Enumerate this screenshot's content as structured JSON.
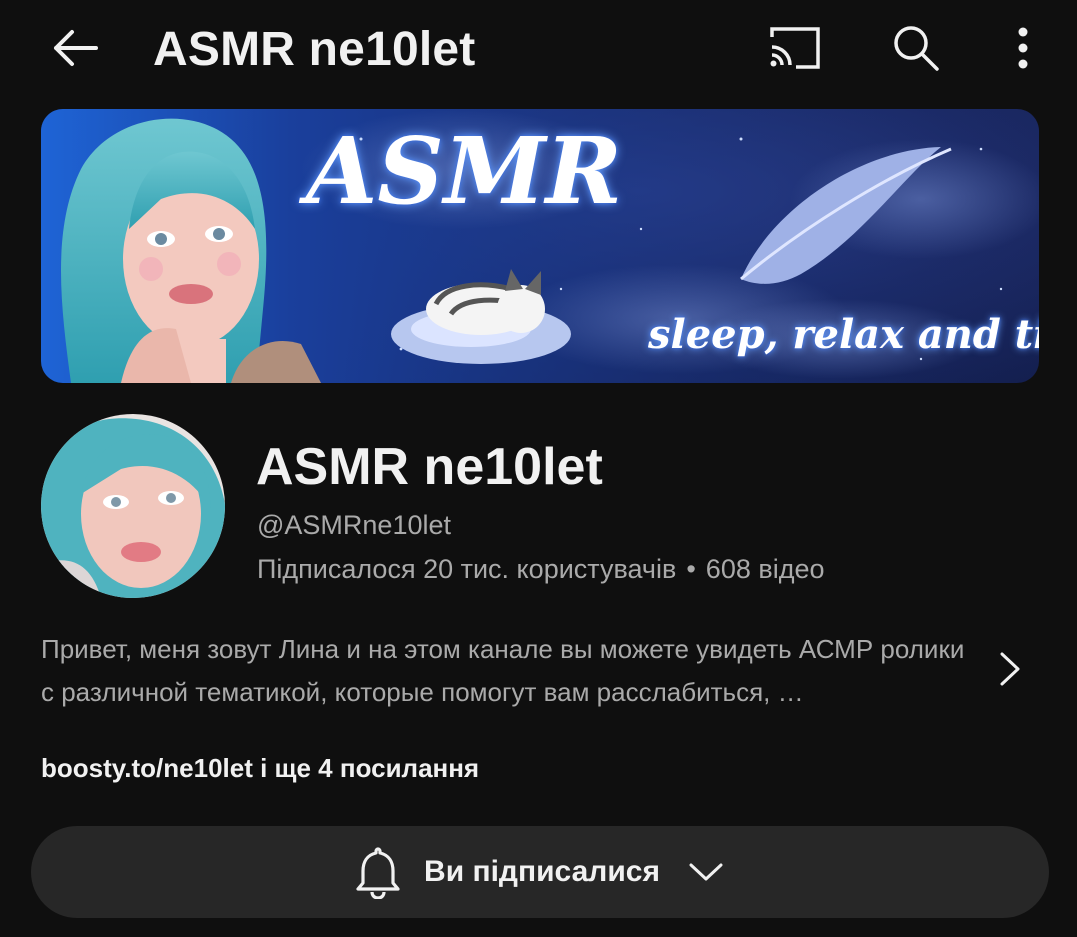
{
  "topbar": {
    "title": "ASMR ne10let",
    "back_icon": "arrow-back-icon",
    "cast_icon": "cast-icon",
    "search_icon": "search-icon",
    "more_icon": "more-vert-icon"
  },
  "banner": {
    "title": "ASMR",
    "tagline": "sleep, relax and tingles"
  },
  "channel": {
    "name": "ASMR ne10let",
    "handle": "@ASMRne10let",
    "subscribers": "Підписалося 20 тис. користувачів",
    "separator": "•",
    "videos": "608 відео"
  },
  "description": {
    "text": "Привет, меня зовут Лина и на этом канале вы можете увидеть АСМР ролики с различной тематикой, которые помогут вам расслабиться, …"
  },
  "links": {
    "text": "boosty.to/ne10let і ще 4 посилання"
  },
  "subscribe": {
    "label": "Ви підписалися"
  },
  "colors": {
    "background": "#0f0f0f",
    "text_primary": "#f1f1f1",
    "text_secondary": "#aaaaaa",
    "button_bg": "#272727"
  }
}
